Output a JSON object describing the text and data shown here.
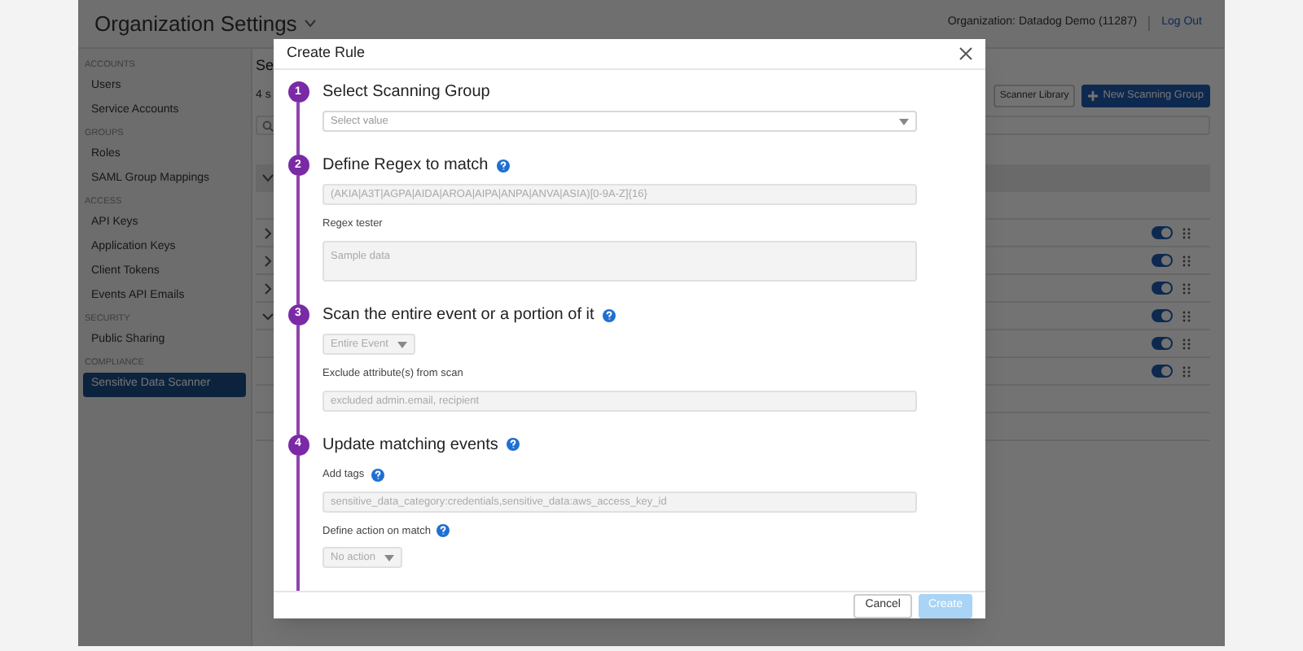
{
  "header": {
    "title": "Organization Settings",
    "organization": "Organization: Datadog Demo (11287)",
    "logout": "Log Out"
  },
  "sidebar": {
    "sections": [
      {
        "heading": "ACCOUNTS",
        "items": [
          {
            "label": "Users",
            "selected": false
          },
          {
            "label": "Service Accounts",
            "selected": false
          }
        ]
      },
      {
        "heading": "GROUPS",
        "items": [
          {
            "label": "Roles",
            "selected": false
          },
          {
            "label": "SAML Group Mappings",
            "selected": false
          }
        ]
      },
      {
        "heading": "ACCESS",
        "items": [
          {
            "label": "API Keys",
            "selected": false
          },
          {
            "label": "Application Keys",
            "selected": false
          },
          {
            "label": "Client Tokens",
            "selected": false
          },
          {
            "label": "Events API Emails",
            "selected": false
          }
        ]
      },
      {
        "heading": "SECURITY",
        "items": [
          {
            "label": "Public Sharing",
            "selected": false
          }
        ]
      },
      {
        "heading": "COMPLIANCE",
        "items": [
          {
            "label": "Sensitive Data Scanner",
            "selected": true
          }
        ]
      }
    ]
  },
  "page": {
    "title": "Se",
    "subtitle": "4 s",
    "library_button": "Scanner Library",
    "new_button": "New Scanning Group"
  },
  "table": {
    "rows": [
      {
        "kind": "group",
        "expanded": false,
        "on": true
      },
      {
        "kind": "group",
        "expanded": false,
        "on": true
      },
      {
        "kind": "group",
        "expanded": false,
        "on": true
      },
      {
        "kind": "group",
        "expanded": true,
        "on": true
      },
      {
        "kind": "rule",
        "on": true
      },
      {
        "kind": "rule",
        "on": true
      }
    ]
  },
  "modal": {
    "title": "Create Rule",
    "steps": [
      {
        "number": "1",
        "title": "Select Scanning Group",
        "info": false,
        "fields": [
          {
            "kind": "select",
            "placeholder": "Select value"
          }
        ]
      },
      {
        "number": "2",
        "title": "Define Regex to match",
        "info": true,
        "fields": [
          {
            "kind": "input",
            "placeholder": "(AKIA|A3T|AGPA|AIDA|AROA|AIPA|ANPA|ANVA|ASIA)[0-9A-Z]{16}"
          },
          {
            "kind": "label",
            "text": "Regex tester",
            "info": false
          },
          {
            "kind": "textarea",
            "placeholder": "Sample data"
          }
        ]
      },
      {
        "number": "3",
        "title": "Scan the entire event or a portion of it",
        "info": true,
        "fields": [
          {
            "kind": "dropdown",
            "value": "Entire Event"
          },
          {
            "kind": "label",
            "text": "Exclude attribute(s) from scan",
            "info": false
          },
          {
            "kind": "input",
            "placeholder": "excluded admin.email, recipient"
          }
        ]
      },
      {
        "number": "4",
        "title": "Update matching events",
        "info": true,
        "fields": [
          {
            "kind": "label",
            "text": "Add tags",
            "info": true
          },
          {
            "kind": "input",
            "placeholder": "sensitive_data_category:credentials,sensitive_data:aws_access_key_id"
          },
          {
            "kind": "label",
            "text": "Define action on match",
            "info": true
          },
          {
            "kind": "dropdown",
            "value": "No action"
          }
        ]
      }
    ],
    "cancel": "Cancel",
    "create": {
      "label": "Create",
      "disabled": true
    }
  }
}
